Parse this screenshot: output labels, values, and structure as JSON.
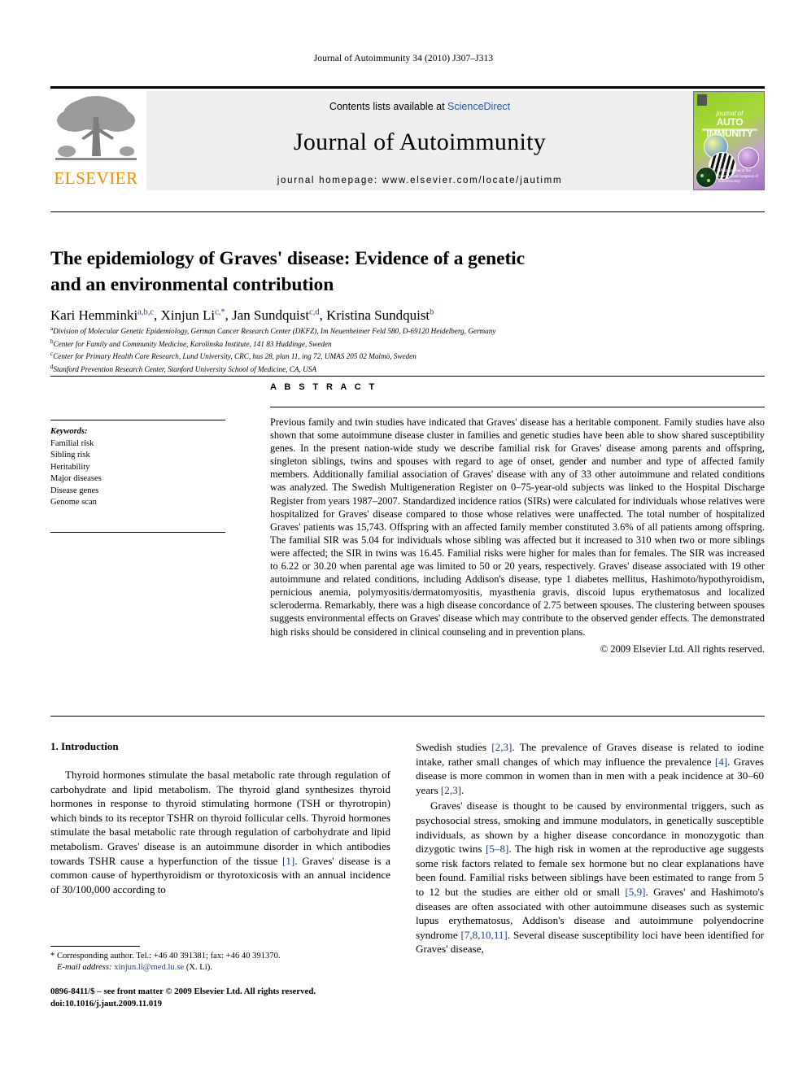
{
  "running_head": "Journal of Autoimmunity 34 (2010) J307–J313",
  "masthead": {
    "contents_prefix": "Contents lists available at",
    "sciencedirect": "ScienceDirect",
    "journal_name": "Journal of Autoimmunity",
    "homepage": "journal homepage: www.elsevier.com/locate/jautimm",
    "publisher_name": "ELSEVIER",
    "cover": {
      "line1": "journal of",
      "line2": "AUTO IMMUNITY",
      "footer": "official journal of the international congress of autoimmunity"
    },
    "colors": {
      "elsevier_orange": "#F08C00",
      "sciencedirect_blue": "#2b58a6",
      "band_grey": "#eeeeee",
      "cover_green": "#8ecf2a",
      "cover_purple": "#9b6fc0"
    }
  },
  "article": {
    "title_line1": "The epidemiology of Graves' disease: Evidence of a genetic",
    "title_line2": "and an environmental contribution",
    "authors": [
      {
        "name": "Kari Hemminki",
        "sup": "a,b,c",
        "sep": ", "
      },
      {
        "name": "Xinjun Li",
        "sup": "c,*",
        "sep": ", "
      },
      {
        "name": "Jan Sundquist",
        "sup": "c,d",
        "sep": ", "
      },
      {
        "name": "Kristina Sundquist",
        "sup": "b",
        "sep": ""
      }
    ],
    "affiliations": [
      {
        "marker": "a",
        "text": "Division of Molecular Genetic Epidemiology, German Cancer Research Center (DKFZ), Im Neuenheimer Feld 580, D-69120 Heidelberg, Germany"
      },
      {
        "marker": "b",
        "text": "Center for Family and Community Medicine, Karolinska Institute, 141 83 Huddinge, Sweden"
      },
      {
        "marker": "c",
        "text": "Center for Primary Health Care Research, Lund University, CRC, hus 28, plan 11, ing 72, UMAS 205 02 Malmö, Sweden"
      },
      {
        "marker": "d",
        "text": "Stanford Prevention Research Center, Stanford University School of Medicine, CA, USA"
      }
    ]
  },
  "keywords": {
    "heading": "Keywords:",
    "items": [
      "Familial risk",
      "Sibling risk",
      "Heritability",
      "Major diseases",
      "Disease genes",
      "Genome scan"
    ]
  },
  "abstract": {
    "heading": "A B S T R A C T",
    "body": "Previous family and twin studies have indicated that Graves' disease has a heritable component. Family studies have also shown that some autoimmune disease cluster in families and genetic studies have been able to show shared susceptibility genes. In the present nation-wide study we describe familial risk for Graves' disease among parents and offspring, singleton siblings, twins and spouses with regard to age of onset, gender and number and type of affected family members. Additionally familial association of Graves' disease with any of 33 other autoimmune and related conditions was analyzed. The Swedish Multigeneration Register on 0–75-year-old subjects was linked to the Hospital Discharge Register from years 1987–2007. Standardized incidence ratios (SIRs) were calculated for individuals whose relatives were hospitalized for Graves' disease compared to those whose relatives were unaffected. The total number of hospitalized Graves' patients was 15,743. Offspring with an affected family member constituted 3.6% of all patients among offspring. The familial SIR was 5.04 for individuals whose sibling was affected but it increased to 310 when two or more siblings were affected; the SIR in twins was 16.45. Familial risks were higher for males than for females. The SIR was increased to 6.22 or 30.20 when parental age was limited to 50 or 20 years, respectively. Graves' disease associated with 19 other autoimmune and related conditions, including Addison's disease, type 1 diabetes mellitus, Hashimoto/hypothyroidism, pernicious anemia, polymyositis/dermatomyositis, myasthenia gravis, discoid lupus erythematosus and localized scleroderma. Remarkably, there was a high disease concordance of 2.75 between spouses. The clustering between spouses suggests environmental effects on Graves' disease which may contribute to the observed gender effects. The demonstrated high risks should be considered in clinical counseling and in prevention plans.",
    "copyright": "© 2009 Elsevier Ltd. All rights reserved."
  },
  "introduction": {
    "heading": "1. Introduction",
    "left_paragraph_part1": "Thyroid hormones stimulate the basal metabolic rate through regulation of carbohydrate and lipid metabolism. The thyroid gland synthesizes thyroid hormones in response to thyroid stimulating hormone (TSH or thyrotropin) which binds to its receptor TSHR on thyroid follicular cells. Thyroid hormones stimulate the basal metabolic rate through regulation of carbohydrate and lipid metabolism. Graves' disease is an autoimmune disorder in which antibodies towards TSHR cause a hyperfunction of the tissue ",
    "left_ref1": "[1]",
    "left_paragraph_part2": ". Graves' disease is a common cause of hyperthyroidism or thyrotoxicosis with an annual incidence of 30/100,000 according to ",
    "right_para1_a": "Swedish studies ",
    "right_ref_23a": "[2,3]",
    "right_para1_b": ". The prevalence of Graves disease is related to iodine intake, rather small changes of which may influence the prevalence ",
    "right_ref_4": "[4]",
    "right_para1_c": ". Graves disease is more common in women than in men with a peak incidence at 30–60 years ",
    "right_ref_23b": "[2,3]",
    "right_para1_d": ".",
    "right_para2_a": "Graves' disease is thought to be caused by environmental triggers, such as psychosocial stress, smoking and immune modulators, in genetically susceptible individuals, as shown by a higher disease concordance in monozygotic than dizygotic twins ",
    "right_ref_58": "[5–8]",
    "right_para2_b": ". The high risk in women at the reproductive age suggests some risk factors related to female sex hormone but no clear explanations have been found. Familial risks between siblings have been estimated to range from 5 to 12 but the studies are either old or small ",
    "right_ref_59": "[5,9]",
    "right_para2_c": ". Graves' and Hashimoto's diseases are often associated with other autoimmune diseases such as systemic lupus erythematosus, Addison's disease and autoimmune polyendocrine syndrome ",
    "right_ref_781011": "[7,8,10,11]",
    "right_para2_d": ". Several disease susceptibility loci have been identified for Graves' disease,"
  },
  "footnotes": {
    "corresponding": "* Corresponding author. Tel.: +46 40 391381; fax: +46 40 391370.",
    "email_label": "E-mail address:",
    "email": "xinjun.li@med.lu.se",
    "email_suffix": "(X. Li)."
  },
  "imprint": {
    "line1": "0896-8411/$ – see front matter © 2009 Elsevier Ltd. All rights reserved.",
    "line2": "doi:10.1016/j.jaut.2009.11.019"
  }
}
